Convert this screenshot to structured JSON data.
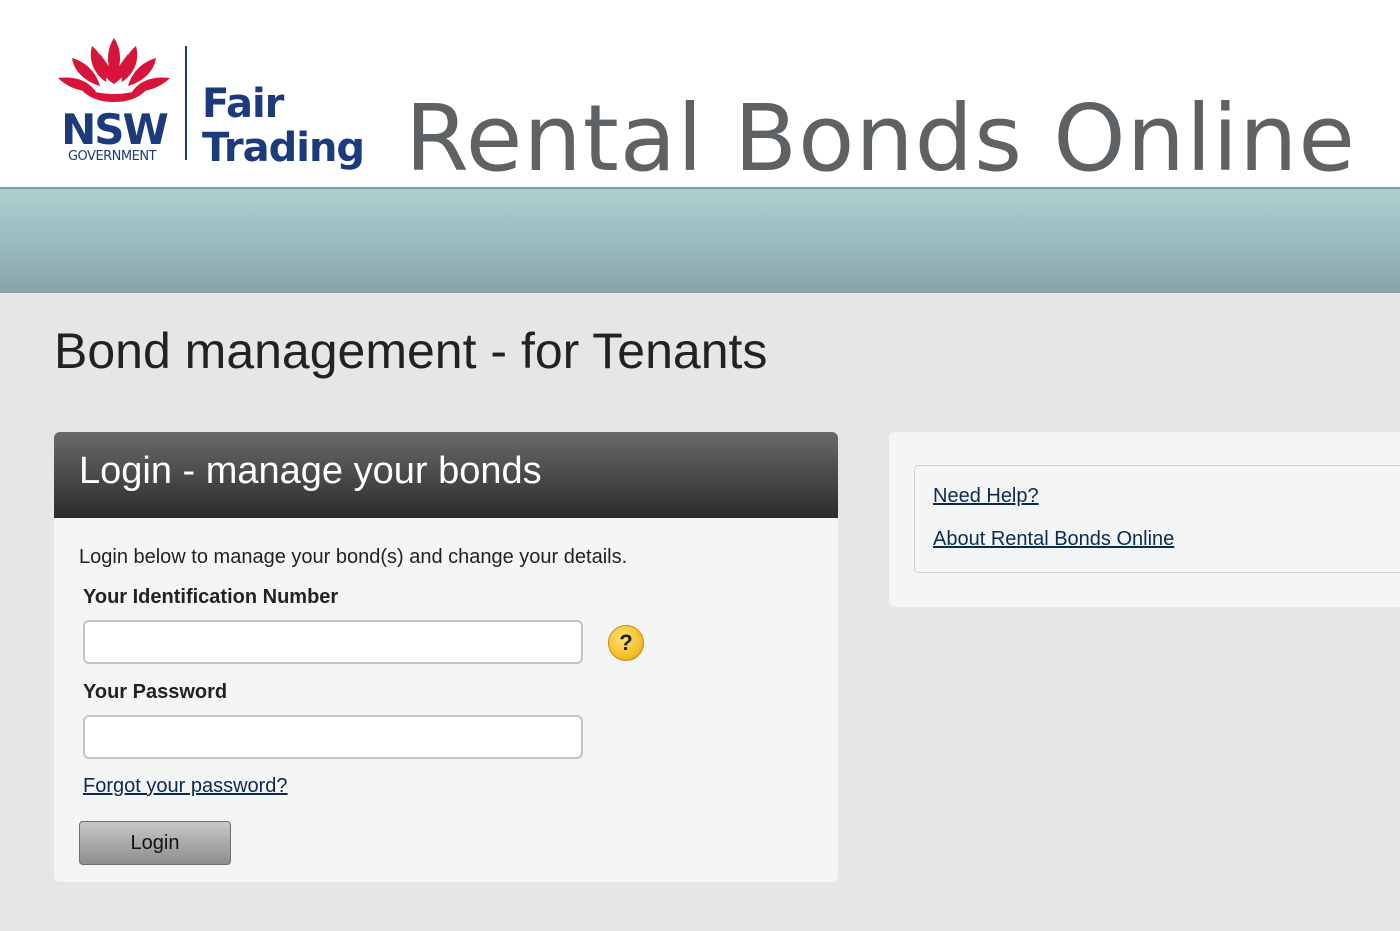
{
  "header": {
    "logo": {
      "name": "nsw-government-waratah-logo",
      "wordmark": "NSW",
      "subtext": "GOVERNMENT",
      "colors": {
        "red": "#d7153a",
        "navy": "#1d3a7a"
      }
    },
    "department_line1": "Fair",
    "department_line2": "Trading",
    "site_title": "Rental Bonds Online"
  },
  "page": {
    "title": "Bond management - for Tenants"
  },
  "login": {
    "panel_title": "Login - manage your bonds",
    "intro": "Login below to manage your bond(s) and change your details.",
    "id_label": "Your Identification Number",
    "id_value": "",
    "password_label": "Your Password",
    "password_value": "",
    "help_icon": "question-mark-icon",
    "help_glyph": "?",
    "forgot_link": "Forgot your password?",
    "button_label": "Login"
  },
  "help": {
    "links": [
      {
        "label": "Need Help?"
      },
      {
        "label": "About Rental Bonds Online"
      }
    ]
  },
  "colors": {
    "page_background": "#e6e6e6",
    "banner": "#9bbcbf",
    "panel_header": "#3a3a3a",
    "panel_background": "#f4f6f5",
    "link": "#0b2a52",
    "help_icon": "#f3c12e"
  }
}
